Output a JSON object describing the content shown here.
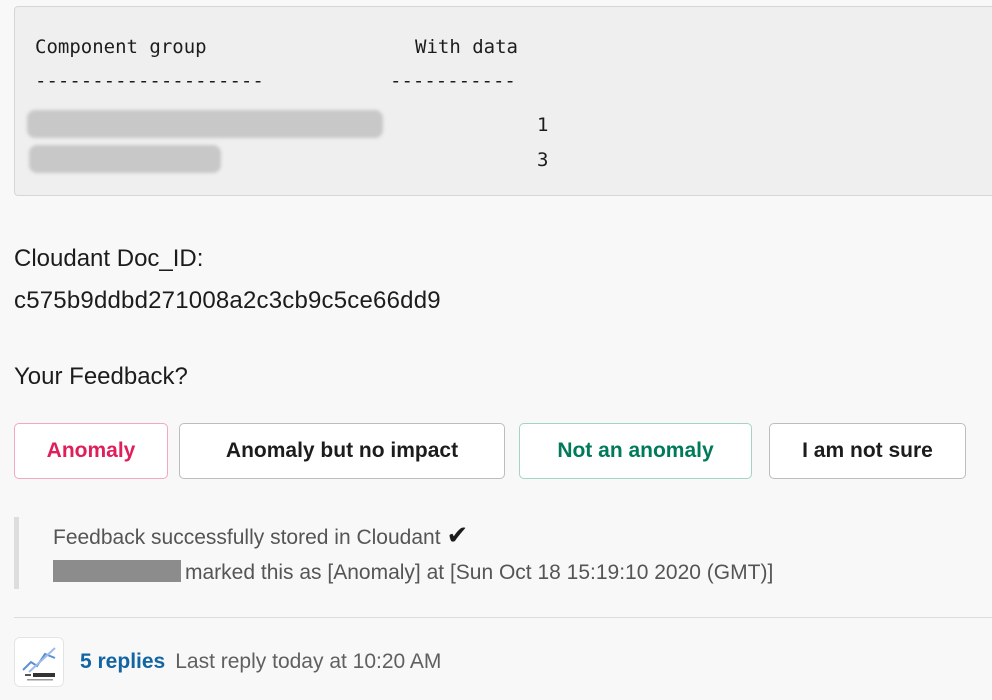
{
  "code_block": {
    "header_col1": "Component group",
    "header_col2": "With data",
    "separator_col1": "--------------------",
    "separator_col2": "-----------",
    "rows": [
      {
        "value": "1"
      },
      {
        "value": "3"
      }
    ]
  },
  "doc": {
    "label": "Cloudant Doc_ID:",
    "id": "c575b9ddbd271008a2c3cb9c5ce66dd9"
  },
  "feedback": {
    "question": "Your Feedback?",
    "buttons": {
      "anomaly": "Anomaly",
      "anomaly_no_impact": "Anomaly but no impact",
      "not_anomaly": "Not an anomaly",
      "not_sure": "I am not sure"
    },
    "colors": {
      "anomaly": "#e01e5a",
      "not_anomaly": "#007a5a"
    }
  },
  "attachment": {
    "line1": "Feedback successfully stored in Cloudant",
    "checkmark": "✔",
    "line2": "marked this as [Anomaly] at [Sun Oct 18 15:19:10 2020 (GMT)]"
  },
  "thread": {
    "avatar_icon": "app-bot-icon",
    "replies_label": "5 replies",
    "last_reply": "Last reply today at 10:20 AM",
    "link_color": "#1264a3"
  }
}
